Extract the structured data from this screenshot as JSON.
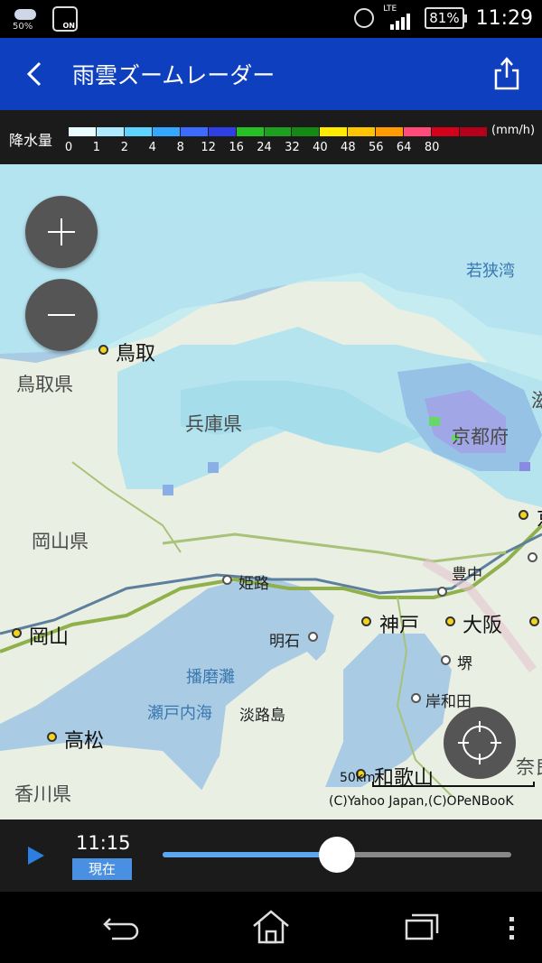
{
  "status_bar": {
    "weather_percent": "50%",
    "nfc_label": "ON",
    "network": "LTE",
    "battery": "81%",
    "time": "11:29"
  },
  "app_bar": {
    "title": "雨雲ズームレーダー"
  },
  "legend": {
    "label": "降水量",
    "unit": "(mm/h)",
    "ticks": [
      "0",
      "1",
      "2",
      "4",
      "8",
      "12",
      "16",
      "24",
      "32",
      "40",
      "48",
      "56",
      "64",
      "80"
    ],
    "colors": [
      "#e8fbff",
      "#aeeaff",
      "#5fd2ff",
      "#34a8ff",
      "#3e6bff",
      "#2f3fe6",
      "#26c026",
      "#1f9f1f",
      "#148a14",
      "#ffeb00",
      "#ffc400",
      "#ff9a00",
      "#ff4a7a",
      "#d5001a",
      "#b4001a"
    ]
  },
  "map": {
    "prefectures": [
      "鳥取県",
      "兵庫県",
      "岡山県",
      "京都府",
      "香川県"
    ],
    "cities_major": [
      "鳥取",
      "岡山",
      "神戸",
      "大阪",
      "高松",
      "和歌山"
    ],
    "cities_minor": [
      "姫路",
      "豊中",
      "明石",
      "堺",
      "岸和田",
      "淡路島"
    ],
    "seas": [
      "若狭湾",
      "播磨灘",
      "瀬戸内海"
    ],
    "partial_labels": [
      "滋",
      "京",
      "奈良"
    ],
    "scale_label": "50km",
    "copyright": "(C)Yahoo Japan,(C)OPeNBooK"
  },
  "player": {
    "time": "11:15",
    "now_label": "現在",
    "progress": 0.5
  },
  "icons": {
    "back": "chevron-left-icon",
    "share": "share-icon",
    "zoom_in": "plus-icon",
    "zoom_out": "minus-icon",
    "locate": "crosshair-icon",
    "play": "play-icon",
    "nav_back": "back-arrow-icon",
    "nav_home": "home-icon",
    "nav_recents": "recents-icon",
    "nav_menu": "more-vertical-icon"
  }
}
